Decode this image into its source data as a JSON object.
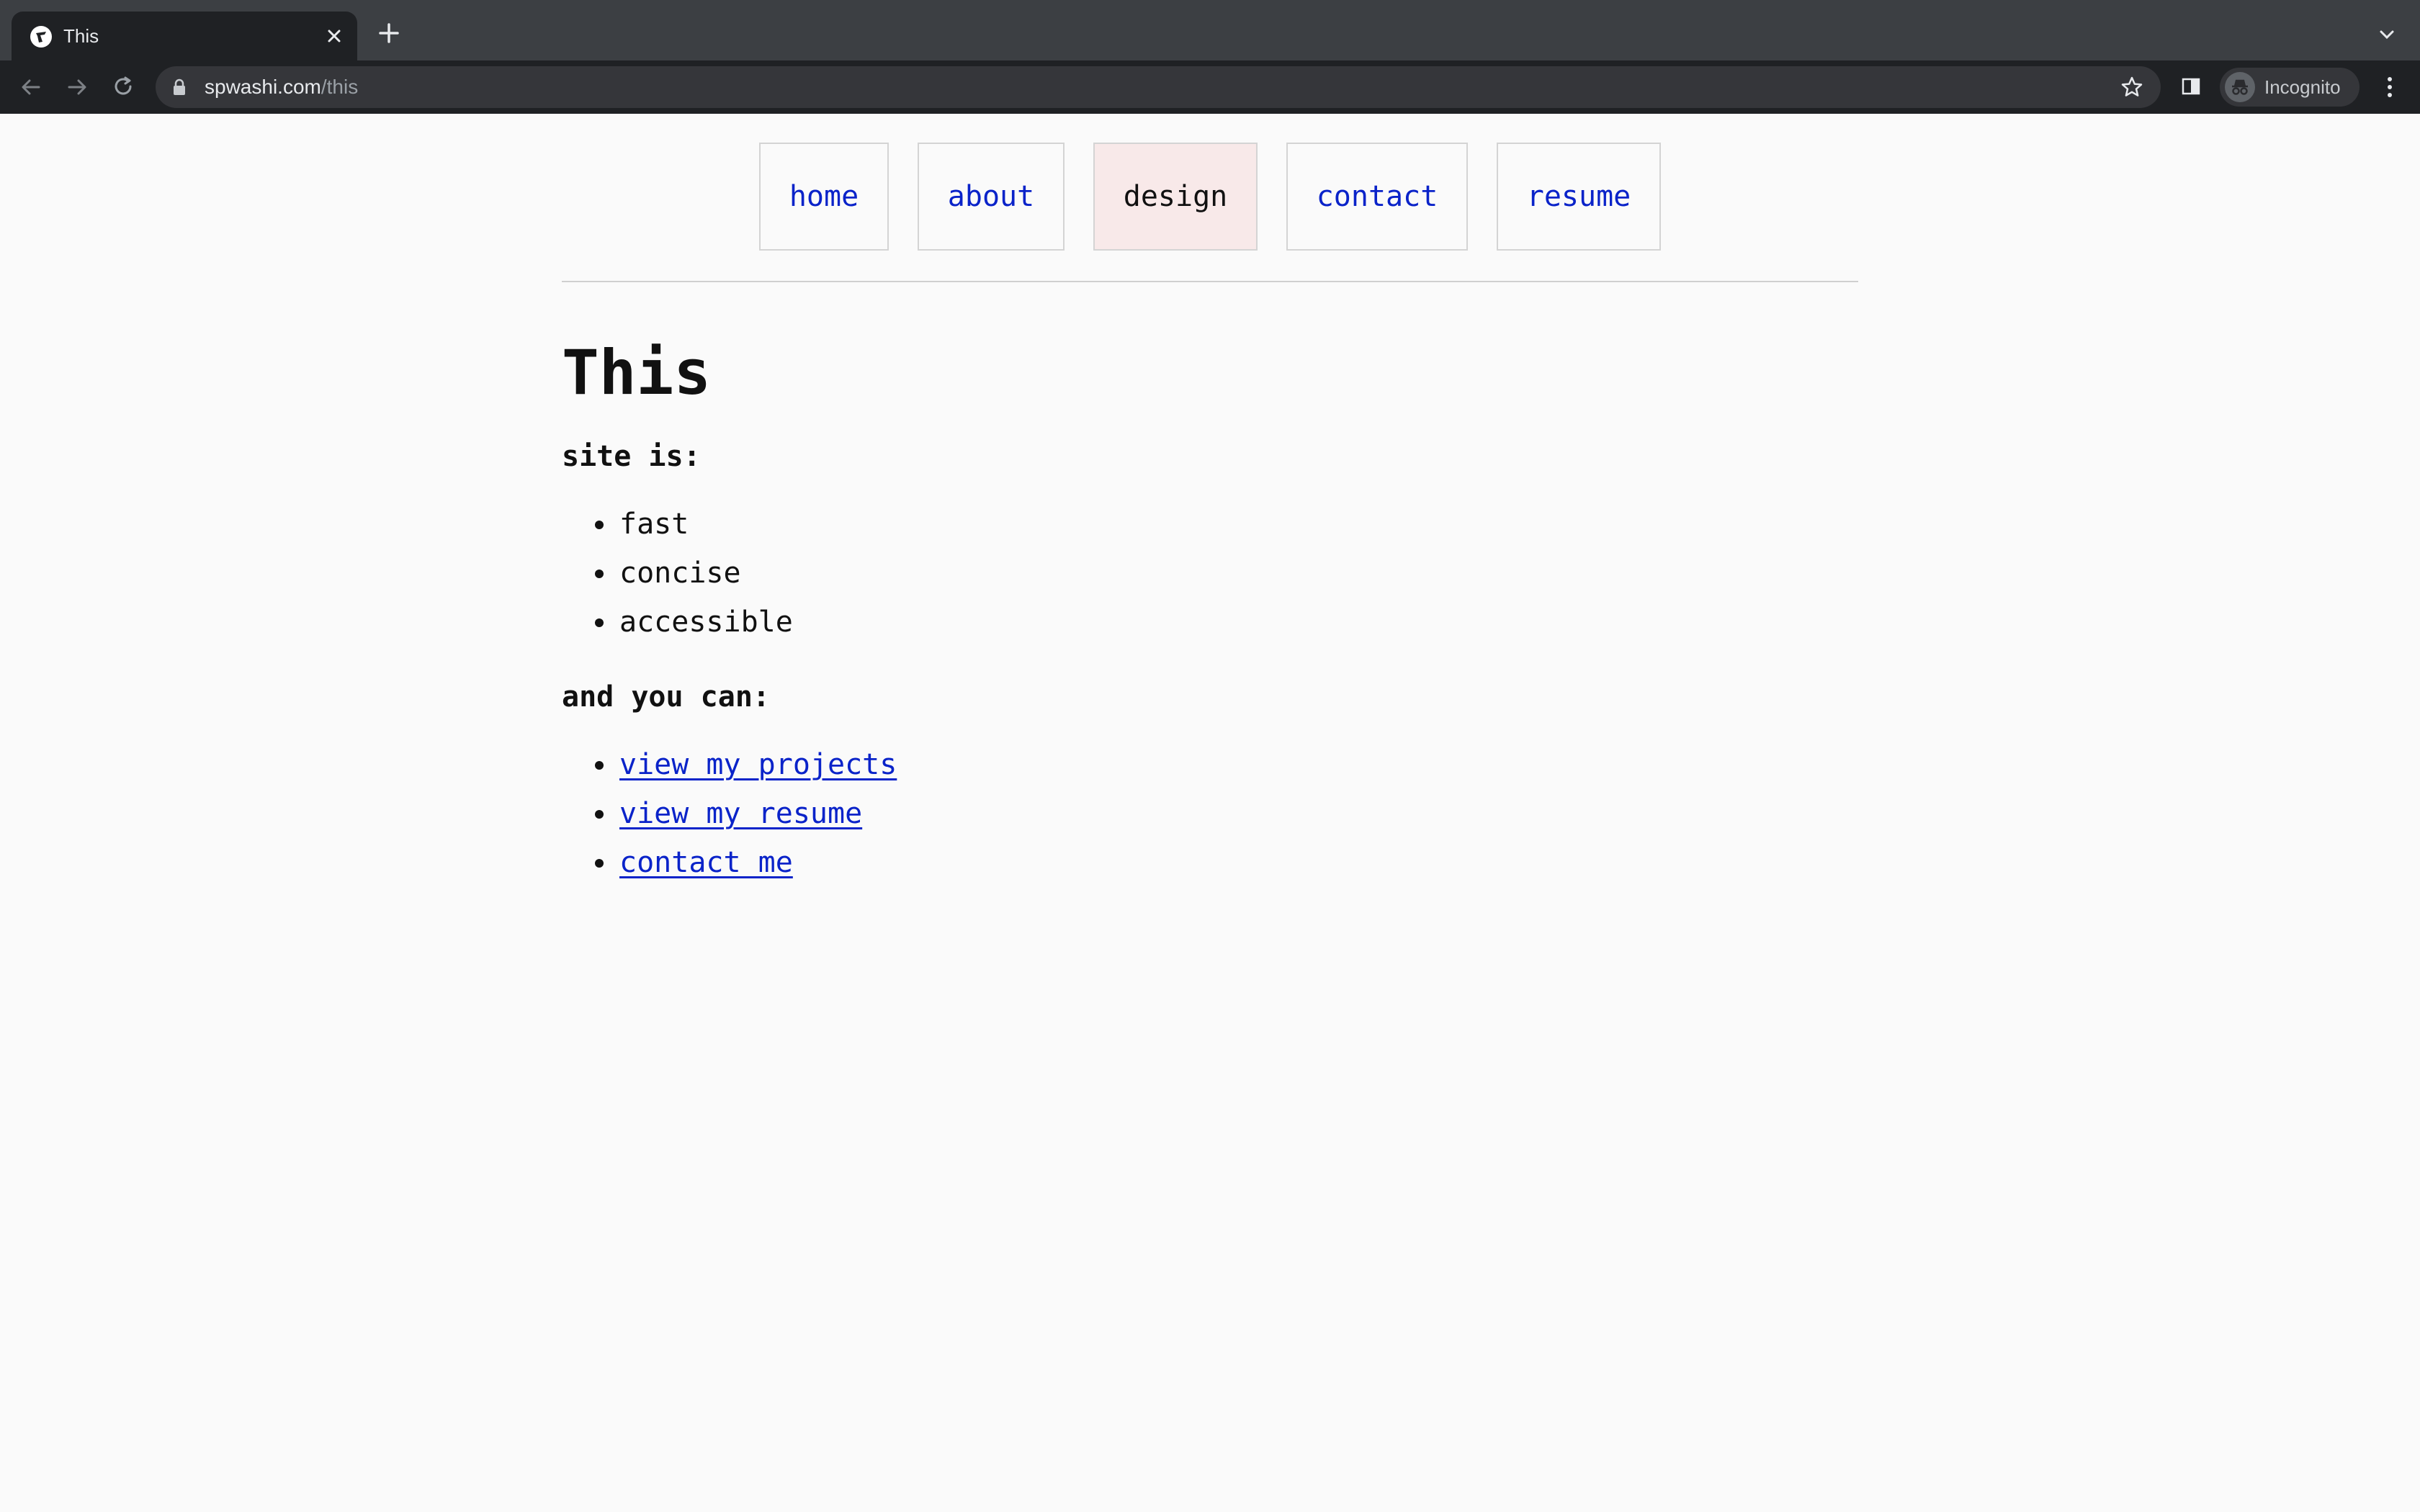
{
  "browser": {
    "tab_title": "This",
    "url_host": "spwashi.com",
    "url_path": "/this",
    "profile_label": "Incognito"
  },
  "nav": {
    "items": [
      {
        "label": "home",
        "active": false
      },
      {
        "label": "about",
        "active": false
      },
      {
        "label": "design",
        "active": true
      },
      {
        "label": "contact",
        "active": false
      },
      {
        "label": "resume",
        "active": false
      }
    ]
  },
  "page": {
    "title": "This",
    "section1_heading": "site is:",
    "qualities": [
      "fast",
      "concise",
      "accessible"
    ],
    "section2_heading": "and you can:",
    "links": [
      "view my projects",
      "view my resume",
      "contact me"
    ]
  },
  "colors": {
    "link": "#0a23c9",
    "active_nav_bg": "#f8e9e9",
    "chrome_dark": "#1f2124",
    "tabstrip": "#3c3f43"
  }
}
